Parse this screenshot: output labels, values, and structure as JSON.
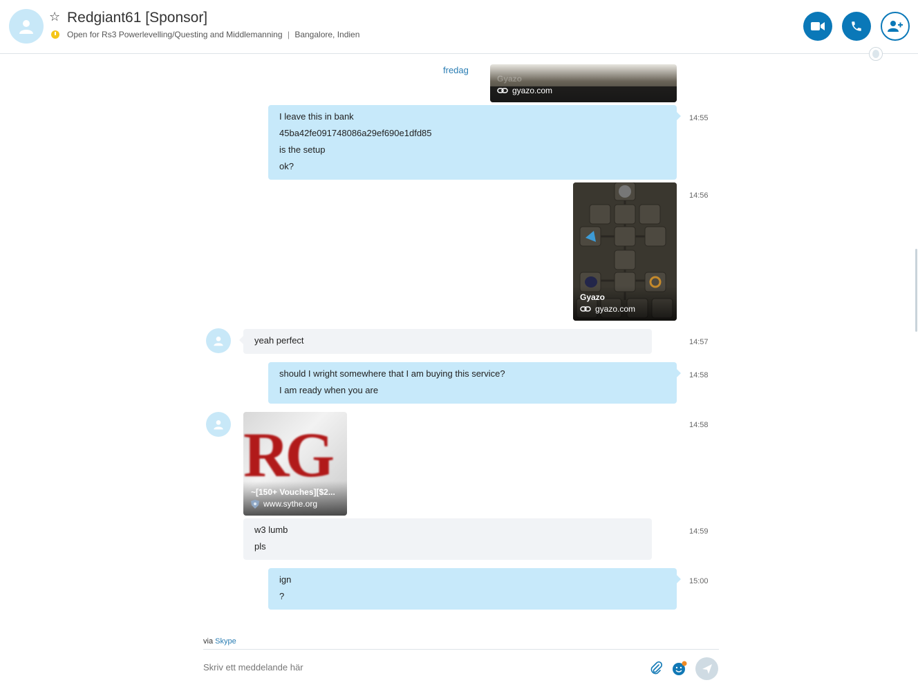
{
  "header": {
    "title": "Redgiant61 [Sponsor]",
    "mood": "Open for Rs3 Powerlevelling/Questing and Middlemanning",
    "separator": "|",
    "location": "Bangalore, Indien",
    "status_color": "#f5c518",
    "buttons": [
      {
        "name": "video-call",
        "icon": "video-camera-icon"
      },
      {
        "name": "audio-call",
        "icon": "phone-icon"
      },
      {
        "name": "add-people",
        "icon": "add-person-icon"
      }
    ]
  },
  "chat": {
    "day_label": "fredag",
    "top_card": {
      "title": "Gyazo",
      "domain": "gyazo.com"
    },
    "messages": [
      {
        "dir": "out",
        "time": "14:55",
        "lines": [
          "I leave this in bank",
          "45ba42fe091748086a29ef690e1dfd85",
          "is the setup",
          "ok?"
        ]
      },
      {
        "dir": "out",
        "time": "14:56",
        "card": {
          "title": "Gyazo",
          "domain": "gyazo.com"
        }
      },
      {
        "dir": "in",
        "time": "14:57",
        "lines": [
          "yeah perfect"
        ]
      },
      {
        "dir": "out",
        "time": "14:58",
        "lines": [
          "should I wright somewhere that I am buying this service?",
          "I am ready when you are"
        ]
      },
      {
        "dir": "in",
        "time": "14:58",
        "card": {
          "title": "~[150+ Vouches][$2...",
          "domain": "www.sythe.org",
          "image_text": "RG"
        }
      },
      {
        "dir": "in",
        "time": "14:59",
        "lines": [
          "w3 lumb",
          "pls"
        ]
      },
      {
        "dir": "out",
        "time": "15:00",
        "lines": [
          "ign",
          "?"
        ]
      }
    ]
  },
  "footer": {
    "via_prefix": "via",
    "via_link": "Skype",
    "compose_placeholder": "Skriv ett meddelande här"
  },
  "colors": {
    "accent": "#0a78b8",
    "outgoing_bubble": "#c7e9fa",
    "incoming_bubble": "#f1f3f6",
    "link": "#2a7db3"
  }
}
